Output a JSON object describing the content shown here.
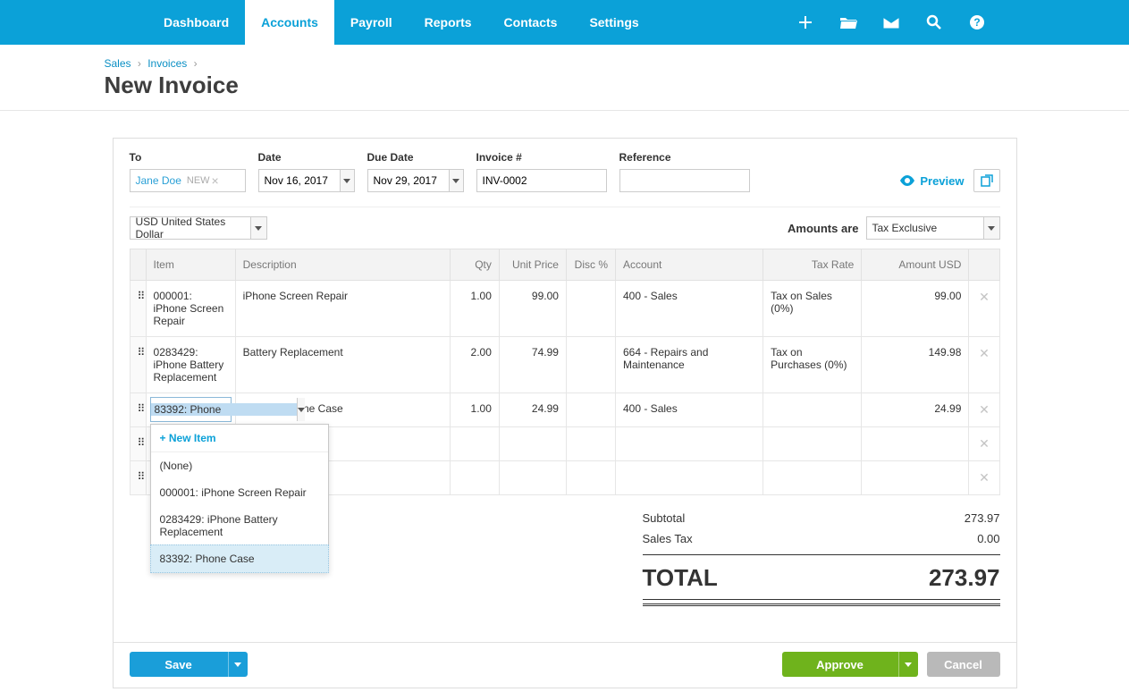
{
  "nav": {
    "items": [
      "Dashboard",
      "Accounts",
      "Payroll",
      "Reports",
      "Contacts",
      "Settings"
    ],
    "active_index": 1
  },
  "breadcrumb": {
    "sales": "Sales",
    "invoices": "Invoices"
  },
  "page_title": "New Invoice",
  "fields": {
    "to_label": "To",
    "to_value": "Jane Doe",
    "to_new": "NEW",
    "date_label": "Date",
    "date_value": "Nov 16, 2017",
    "due_label": "Due Date",
    "due_value": "Nov 29, 2017",
    "inv_label": "Invoice #",
    "inv_value": "INV-0002",
    "ref_label": "Reference",
    "ref_value": ""
  },
  "preview_label": "Preview",
  "currency": {
    "value": "USD United States Dollar"
  },
  "amounts_are": {
    "label": "Amounts are",
    "value": "Tax Exclusive"
  },
  "table": {
    "headers": {
      "item": "Item",
      "desc": "Description",
      "qty": "Qty",
      "price": "Unit Price",
      "disc": "Disc %",
      "account": "Account",
      "tax": "Tax Rate",
      "amount": "Amount USD"
    },
    "rows": [
      {
        "item": "000001: iPhone Screen Repair",
        "desc": "iPhone Screen Repair",
        "qty": "1.00",
        "price": "99.00",
        "disc": "",
        "account": "400 - Sales",
        "tax": "Tax on Sales (0%)",
        "amount": "99.00"
      },
      {
        "item": "0283429: iPhone Battery Replacement",
        "desc": "Battery Replacement",
        "qty": "2.00",
        "price": "74.99",
        "disc": "",
        "account": "664 - Repairs and Maintenance",
        "tax": "Tax on Purchases (0%)",
        "amount": "149.98"
      },
      {
        "item_editing": "83392: Phone ",
        "desc": "Orange iPhone Case",
        "qty": "1.00",
        "price": "24.99",
        "disc": "",
        "account": "400 - Sales",
        "tax": "",
        "amount": "24.99"
      }
    ]
  },
  "dropdown": {
    "new_item": "+ New Item",
    "options": [
      "(None)",
      "000001: iPhone Screen Repair",
      "0283429: iPhone Battery Replacement",
      "83392: Phone Case"
    ],
    "highlighted_index": 3
  },
  "totals": {
    "subtotal_label": "Subtotal",
    "subtotal": "273.97",
    "tax_label": "Sales Tax",
    "tax": "0.00",
    "total_label": "TOTAL",
    "total": "273.97"
  },
  "buttons": {
    "save": "Save",
    "approve": "Approve",
    "cancel": "Cancel"
  }
}
